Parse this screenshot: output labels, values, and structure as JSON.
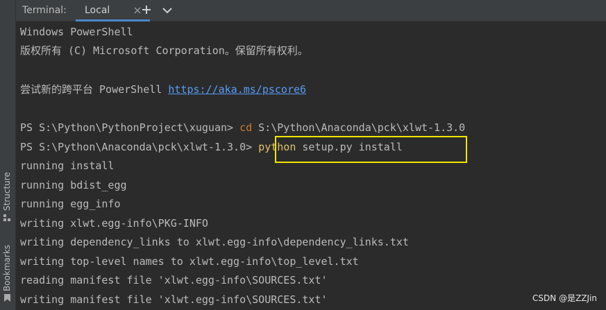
{
  "sidebar": {
    "structure_label": "Structure",
    "bookmarks_label": "Bookmarks"
  },
  "tabbar": {
    "title": "Terminal:",
    "active_tab": "Local",
    "add_icon": "plus-icon",
    "dropdown_icon": "chevron-down-icon",
    "close_icon": "close-icon"
  },
  "terminal": {
    "lines": [
      "Windows PowerShell",
      "版权所有 (C) Microsoft Corporation。保留所有权利。",
      "",
      "尝试新的跨平台 PowerShell ",
      "",
      "PS S:\\Python\\PythonProject\\xuguan> ",
      "PS S:\\Python\\Anaconda\\pck\\xlwt-1.3.0> ",
      "running install",
      "running bdist_egg",
      "running egg_info",
      "writing xlwt.egg-info\\PKG-INFO",
      "writing dependency_links to xlwt.egg-info\\dependency_links.txt",
      "writing top-level names to xlwt.egg-info\\top_level.txt",
      "reading manifest file 'xlwt.egg-info\\SOURCES.txt'",
      "writing manifest file 'xlwt.egg-info\\SOURCES.txt'"
    ],
    "link_text": "https://aka.ms/pscore6",
    "cmd1_keyword": "cd",
    "cmd1_args": " S:\\Python\\Anaconda\\pck\\xlwt-1.3.0",
    "cmd2_keyword": "python",
    "cmd2_args": " setup.py install"
  },
  "watermark": "CSDN @是ZZJin",
  "colors": {
    "background": "#2b2b2b",
    "text": "#bbbbbb",
    "link": "#589df6",
    "keyword": "#cc7832",
    "highlight_box": "#f2e600",
    "tab_underline": "#4a88c7"
  }
}
